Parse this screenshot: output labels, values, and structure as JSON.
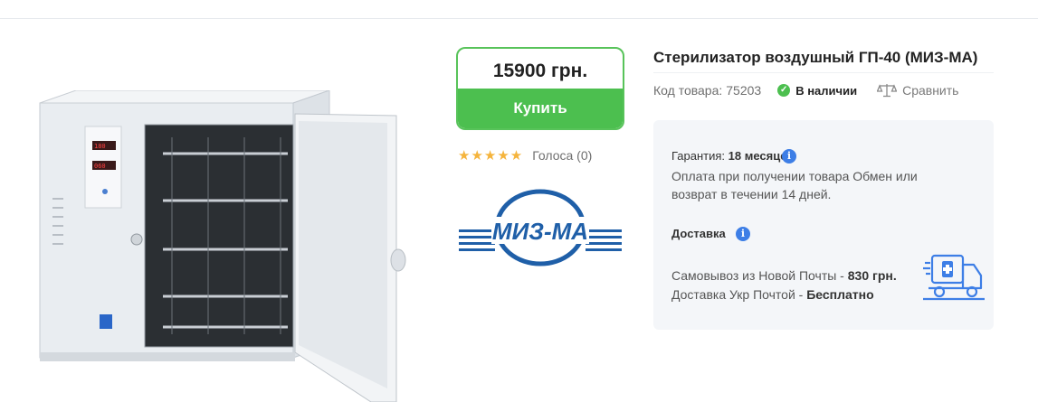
{
  "price_box": {
    "price": "15900 грн.",
    "buy_label": "Купить"
  },
  "rating": {
    "stars": "★★★★★",
    "votes": "Голоса (0)"
  },
  "brand": {
    "logo_text": "МИЗ-МА"
  },
  "product": {
    "title": "Стерилизатор воздушный ГП-40 (МИЗ-МА)",
    "code_label": "Код товара:",
    "code_value": "75203",
    "stock": "В наличии",
    "compare": "Сравнить"
  },
  "info": {
    "warranty_label": "Гарантия:",
    "warranty_value": "18 месяцев",
    "payment_text": "Оплата при получении товара Обмен или возврат в течении 14 дней.",
    "delivery_title": "Доставка",
    "pickup_text": "Самовывоз из Новой Почты - ",
    "pickup_price": "830 грн.",
    "ukrpost_text": "Доставка Укр Почтой - ",
    "ukrpost_price": "Бесплатно"
  },
  "colors": {
    "accent_green": "#4cbf4f",
    "info_blue": "#3d7ee6",
    "logo_blue": "#1f5fa8",
    "star_gold": "#f5b43c"
  }
}
